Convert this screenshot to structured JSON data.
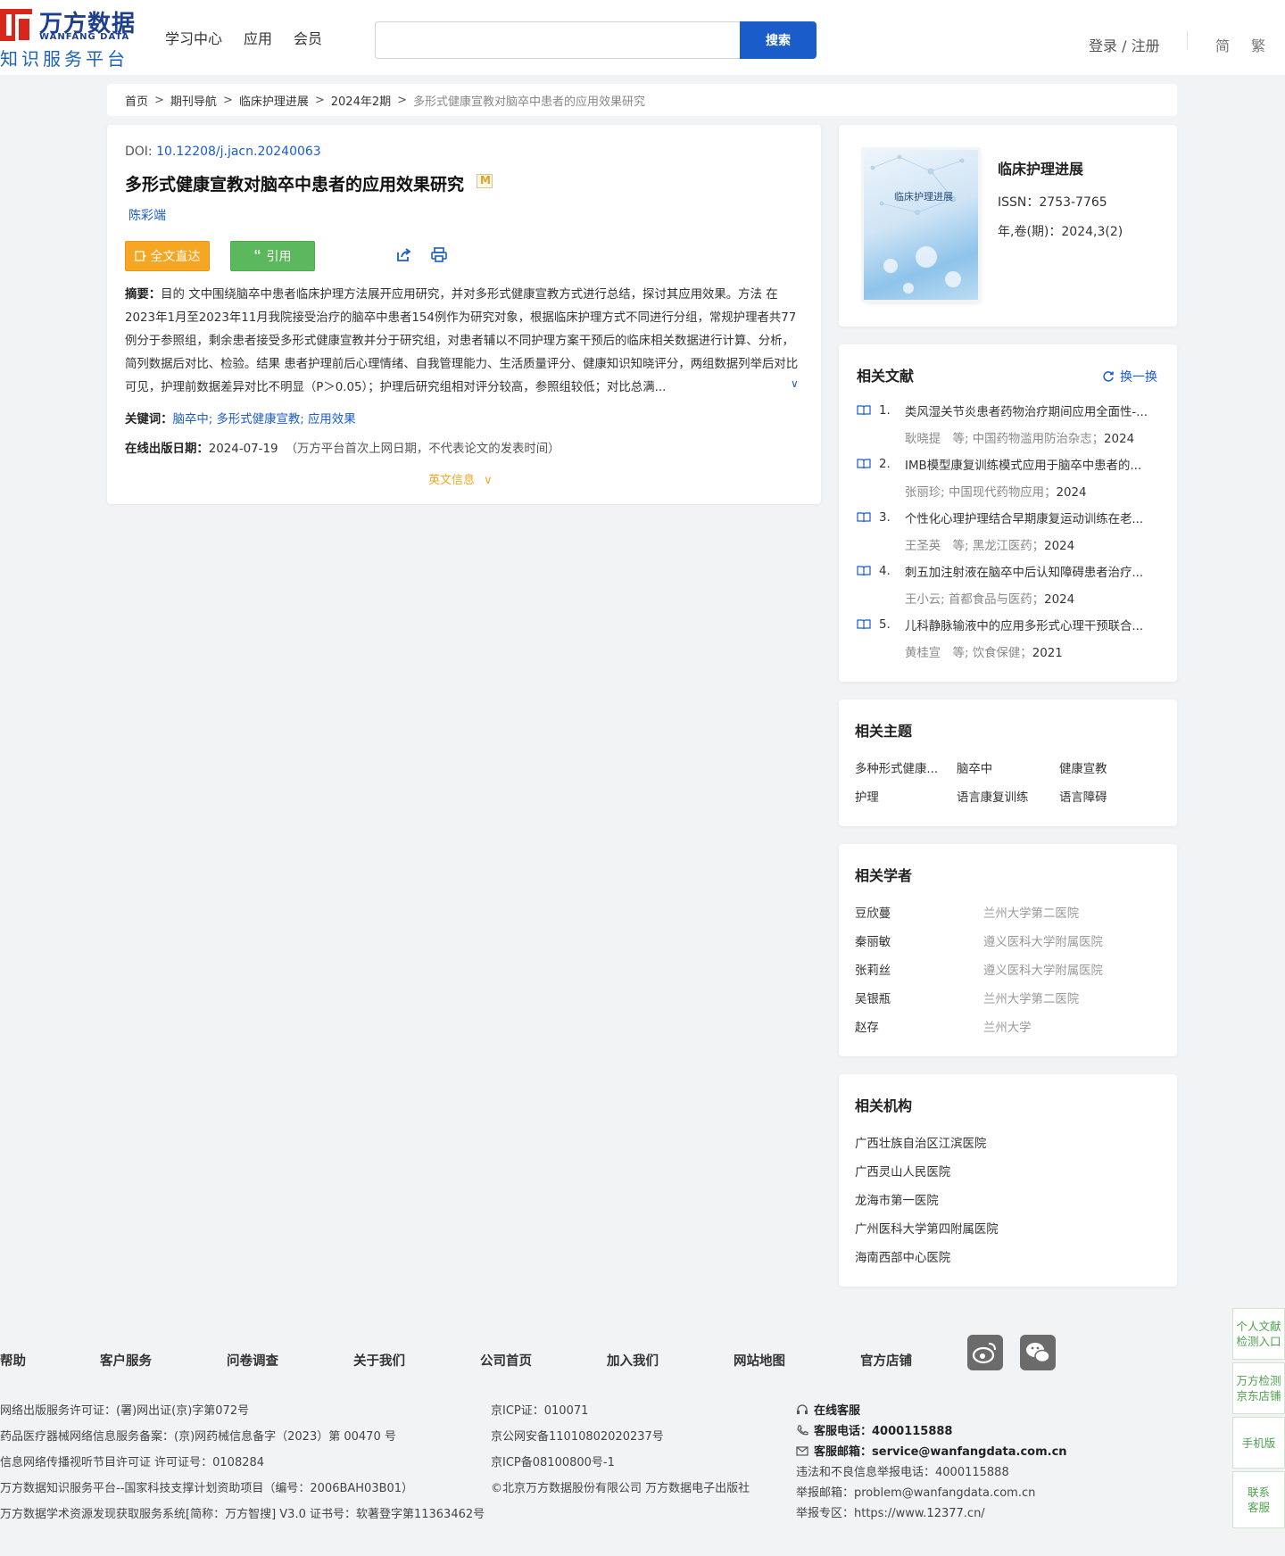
{
  "header": {
    "logo_cn": "万方数据",
    "logo_en": "WANFANG DATA",
    "logo_sub": "知识服务平台",
    "nav": [
      "学习中心",
      "应用",
      "会员"
    ],
    "search_placeholder": "",
    "search_button": "搜索",
    "login": "登录 / 注册",
    "lang_simplified": "简",
    "lang_traditional": "繁"
  },
  "breadcrumb": {
    "items": [
      "首页",
      "期刊导航",
      "临床护理进展",
      "2024年2期"
    ],
    "current": "多形式健康宣教对脑卒中患者的应用效果研究"
  },
  "article": {
    "doi_label": "DOI:",
    "doi": "10.12208/j.jacn.20240063",
    "title": "多形式健康宣教对脑卒中患者的应用效果研究",
    "author": "陈彩端",
    "btn_fulltext": "全文直达",
    "btn_cite": "引用",
    "abstract_label": "摘要：",
    "abstract": "目的 文中围绕脑卒中患者临床护理方法展开应用研究，并对多形式健康宣教方式进行总结，探讨其应用效果。方法 在2023年1月至2023年11月我院接受治疗的脑卒中患者154例作为研究对象，根据临床护理方式不同进行分组，常规护理者共77例分于参照组，剩余患者接受多形式健康宣教并分于研究组，对患者辅以不同护理方案干预后的临床相关数据进行计算、分析，简列数据后对比、检验。结果 患者护理前后心理情绪、自我管理能力、生活质量评分、健康知识知晓评分，两组数据列举后对比可见，护理前数据差异对比不明显（P＞0.05）；护理后研究组相对评分较高，参照组较低；对比总满...",
    "keywords_label": "关键词：",
    "keywords": [
      "脑卒中",
      "多形式健康宣教",
      "应用效果"
    ],
    "pubdate_label": "在线出版日期：",
    "pubdate": "2024-07-19",
    "pubdate_note": "（万方平台首次上网日期，不代表论文的发表时间）",
    "english_info": "英文信息"
  },
  "journal": {
    "cover_title": "临床护理进展",
    "name": "临床护理进展",
    "issn": "ISSN：2753-7765",
    "volume": "年,卷(期)：2024,3(2)"
  },
  "related_literature": {
    "title": "相关文献",
    "refresh": "换一换",
    "items": [
      {
        "num": "1.",
        "title": "类风湿关节炎患者药物治疗期间应用全面性-...",
        "authors": "耿晓提　等; 中国药物滥用防治杂志；",
        "year": "2024"
      },
      {
        "num": "2.",
        "title": "IMB模型康复训练模式应用于脑卒中患者的...",
        "authors": "张丽珍; 中国现代药物应用；",
        "year": "2024"
      },
      {
        "num": "3.",
        "title": "个性化心理护理结合早期康复运动训练在老...",
        "authors": "王圣英　等; 黑龙江医药；",
        "year": "2024"
      },
      {
        "num": "4.",
        "title": "刺五加注射液在脑卒中后认知障碍患者治疗...",
        "authors": "王小云; 首都食品与医药；",
        "year": "2024"
      },
      {
        "num": "5.",
        "title": "儿科静脉输液中的应用多形式心理干预联合...",
        "authors": "黄桂宣　等; 饮食保健；",
        "year": "2021"
      }
    ]
  },
  "related_topics": {
    "title": "相关主题",
    "items": [
      "多种形式健康...",
      "脑卒中",
      "健康宣教",
      "护理",
      "语言康复训练",
      "语言障碍"
    ]
  },
  "related_scholars": {
    "title": "相关学者",
    "items": [
      {
        "name": "豆欣蔓",
        "org": "兰州大学第二医院"
      },
      {
        "name": "秦丽敏",
        "org": "遵义医科大学附属医院"
      },
      {
        "name": "张莉丝",
        "org": "遵义医科大学附属医院"
      },
      {
        "name": "吴银瓶",
        "org": "兰州大学第二医院"
      },
      {
        "name": "赵存",
        "org": "兰州大学"
      }
    ]
  },
  "related_institutions": {
    "title": "相关机构",
    "items": [
      "广西壮族自治区江滨医院",
      "广西灵山人民医院",
      "龙海市第一医院",
      "广州医科大学第四附属医院",
      "海南西部中心医院"
    ]
  },
  "footer": {
    "nav": [
      "帮助",
      "客户服务",
      "问卷调查",
      "关于我们",
      "公司首页",
      "加入我们",
      "网站地图",
      "官方店铺"
    ],
    "social": [
      "weibo-icon",
      "wechat-icon"
    ],
    "left": [
      "网络出版服务许可证：(署)网出证(京)字第072号",
      "药品医疗器械网络信息服务备案：(京)网药械信息备字（2023）第 00470 号",
      "信息网络传播视听节目许可证 许可证号：0108284",
      "万方数据知识服务平台--国家科技支撑计划资助项目（编号：2006BAH03B01）",
      "万方数据学术资源发现获取服务系统[简称：万方智搜] V3.0 证书号：软著登字第11363462号"
    ],
    "middle": [
      "京ICP证：010071",
      "京公网安备11010802020237号",
      "京ICP备08100800号-1",
      "©北京万方数据股份有限公司 万方数据电子出版社"
    ],
    "online_service": "在线客服",
    "phone_label": "客服电话：",
    "phone": "4000115888",
    "email_label": "客服邮箱：",
    "email": "service@wanfangdata.com.cn",
    "report_phone": "违法和不良信息举报电话：4000115888",
    "report_email": "举报邮箱：problem@wanfangdata.com.cn",
    "report_zone": "举报专区：https://www.12377.cn/"
  },
  "side_float": [
    {
      "line1": "个人文献",
      "line2": "检测入口"
    },
    {
      "line1": "万方检测",
      "line2": "京东店铺"
    },
    {
      "line1": "手机版",
      "line2": ""
    },
    {
      "line1": "联系",
      "line2": "客服"
    }
  ],
  "colors": {
    "brand_blue": "#1a5cc9",
    "logo_red": "#d8261c",
    "fulltext_orange": "#f5a623",
    "cite_green": "#5cb85c"
  }
}
